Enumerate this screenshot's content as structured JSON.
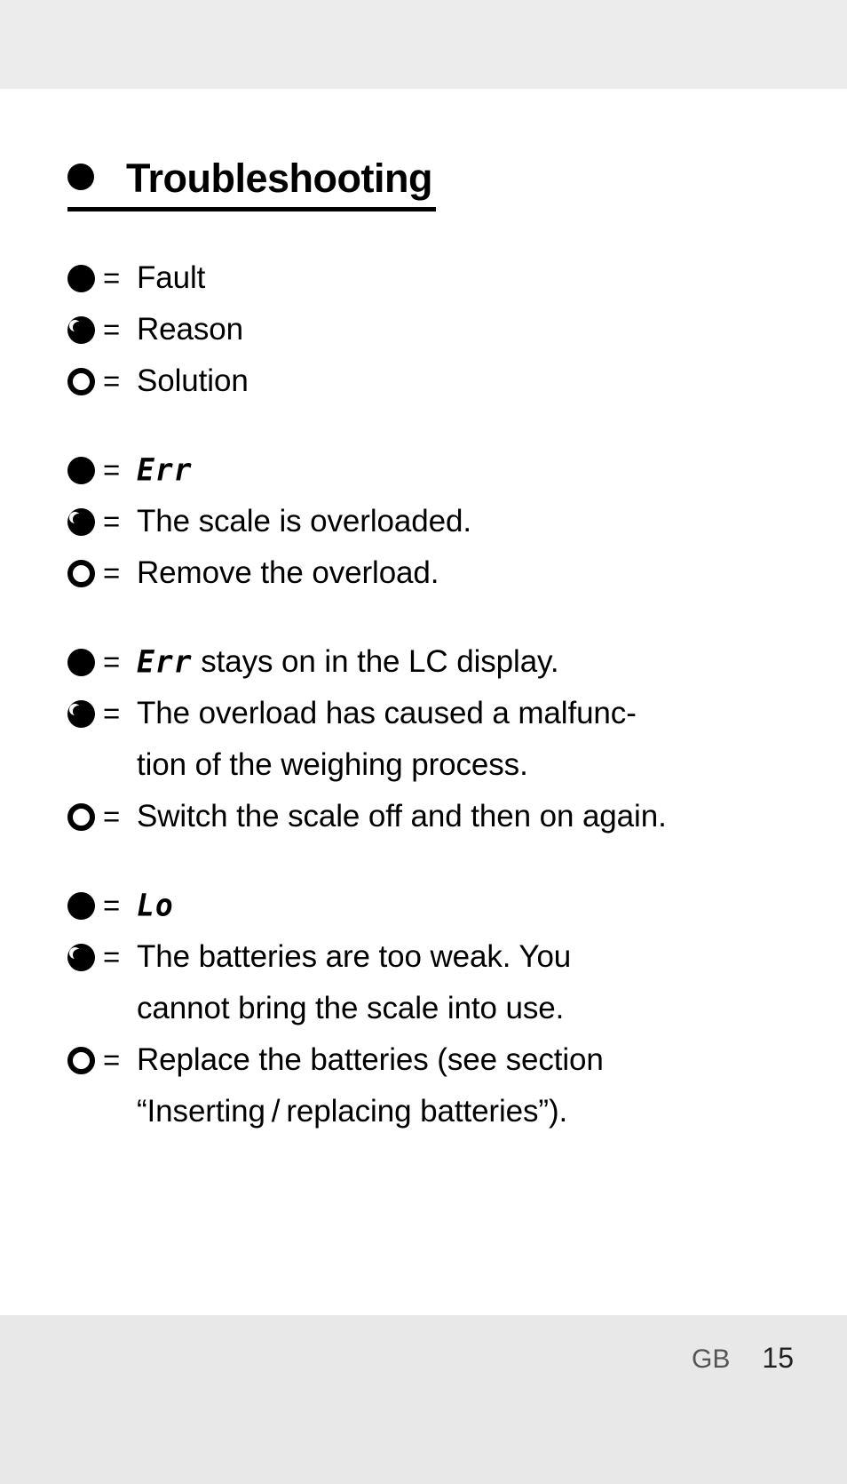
{
  "page": {
    "heading": "Troubleshooting",
    "footer": {
      "lang_code": "GB",
      "page_number": "15"
    }
  },
  "legend": {
    "equals": "=",
    "items": [
      {
        "symbol": "filled-circle",
        "label": "Fault"
      },
      {
        "symbol": "crescent-circle",
        "label": "Reason"
      },
      {
        "symbol": "hollow-circle",
        "label": "Solution"
      }
    ]
  },
  "cases": [
    {
      "fault": {
        "lcd": "Err",
        "text": ""
      },
      "reason": {
        "lines": [
          "The scale is overloaded."
        ]
      },
      "solution": {
        "lines": [
          "Remove the overload."
        ]
      }
    },
    {
      "fault": {
        "lcd": "Err",
        "text": " stays on in the LC display."
      },
      "reason": {
        "lines": [
          "The overload has caused a malfunc-",
          "tion of the weighing process."
        ]
      },
      "solution": {
        "lines": [
          "Switch the scale off and then on again."
        ]
      }
    },
    {
      "fault": {
        "lcd": "Lo",
        "text": ""
      },
      "reason": {
        "lines": [
          "The batteries are too weak. You",
          "cannot bring the scale into use."
        ]
      },
      "solution": {
        "lines": [
          "Replace the batteries (see section",
          "“Inserting / replacing batteries”)."
        ]
      }
    }
  ]
}
